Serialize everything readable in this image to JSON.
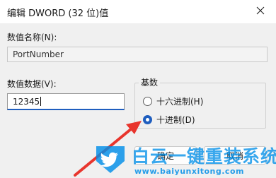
{
  "dialog": {
    "title": "编辑 DWORD (32 位)值",
    "close_glyph": "×"
  },
  "value_name": {
    "label": "数值名称(N):",
    "value": "PortNumber"
  },
  "value_data": {
    "label": "数值数据(V):",
    "value": "12345"
  },
  "base_group": {
    "title": "基数",
    "options": [
      {
        "label": "十六进制(H)",
        "selected": false
      },
      {
        "label": "十进制(D)",
        "selected": true
      }
    ]
  },
  "buttons": {
    "ok": "确定",
    "cancel": "取消"
  },
  "watermark": {
    "brand": "白云一键重装系统",
    "url": "www.baiyunxitong.com"
  },
  "colors": {
    "accent": "#1f5ebf",
    "annotation_arrow": "#e8352d",
    "watermark": "#008ee8"
  },
  "icons": {
    "close": "close-icon",
    "logo": "twitter-bird-icon",
    "annotation": "arrow-icon"
  }
}
